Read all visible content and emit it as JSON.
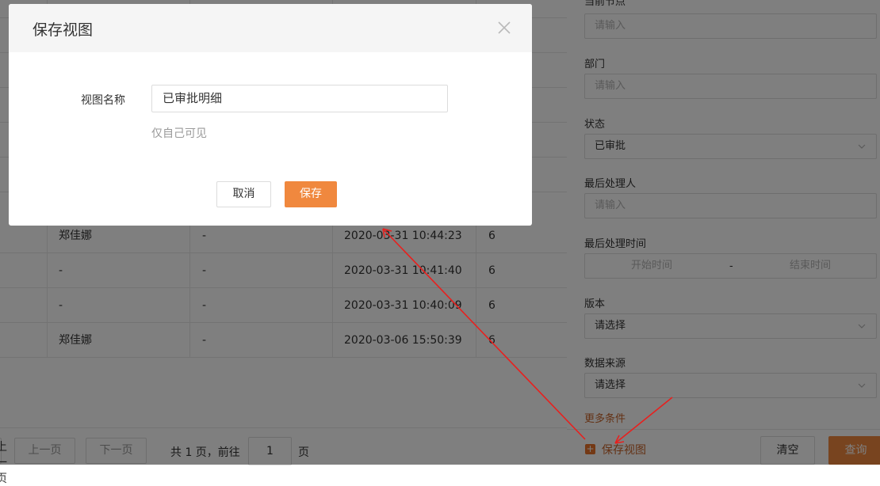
{
  "table": {
    "rows": [
      {
        "handler": "郑佳娜",
        "col2": "-",
        "time": "2020-03-31 10:44:23",
        "num": "6"
      },
      {
        "handler": "-",
        "col2": "-",
        "time": "2020-03-31 10:41:40",
        "num": "6"
      },
      {
        "handler": "-",
        "col2": "-",
        "time": "2020-03-31 10:40:09",
        "num": "6"
      },
      {
        "handler": "郑佳娜",
        "col2": "-",
        "time": "2020-03-06 15:50:39",
        "num": "6"
      }
    ]
  },
  "pagination": {
    "prev_label": "上一页",
    "next_label": "下一页",
    "total_text": "共 1 页，前往",
    "page_value": "1",
    "page_suffix": "页"
  },
  "filters": {
    "current_node": {
      "label": "当前节点",
      "placeholder": "请输入"
    },
    "department": {
      "label": "部门",
      "placeholder": "请输入"
    },
    "status": {
      "label": "状态",
      "value": "已审批"
    },
    "last_handler": {
      "label": "最后处理人",
      "placeholder": "请输入"
    },
    "last_time": {
      "label": "最后处理时间",
      "start_placeholder": "开始时间",
      "separator": "-",
      "end_placeholder": "结束时间"
    },
    "version": {
      "label": "版本",
      "value": "请选择"
    },
    "source": {
      "label": "数据来源",
      "value": "请选择"
    },
    "more_label": "更多条件",
    "save_view_label": "保存视图",
    "clear_label": "清空",
    "query_label": "查询"
  },
  "modal": {
    "title": "保存视图",
    "field_label": "视图名称",
    "field_value": "已审批明细",
    "hint": "仅自己可见",
    "cancel_label": "取消",
    "save_label": "保存"
  },
  "colors": {
    "accent": "#f0883e",
    "link": "#c8642a",
    "annotation": "#e8201e"
  }
}
